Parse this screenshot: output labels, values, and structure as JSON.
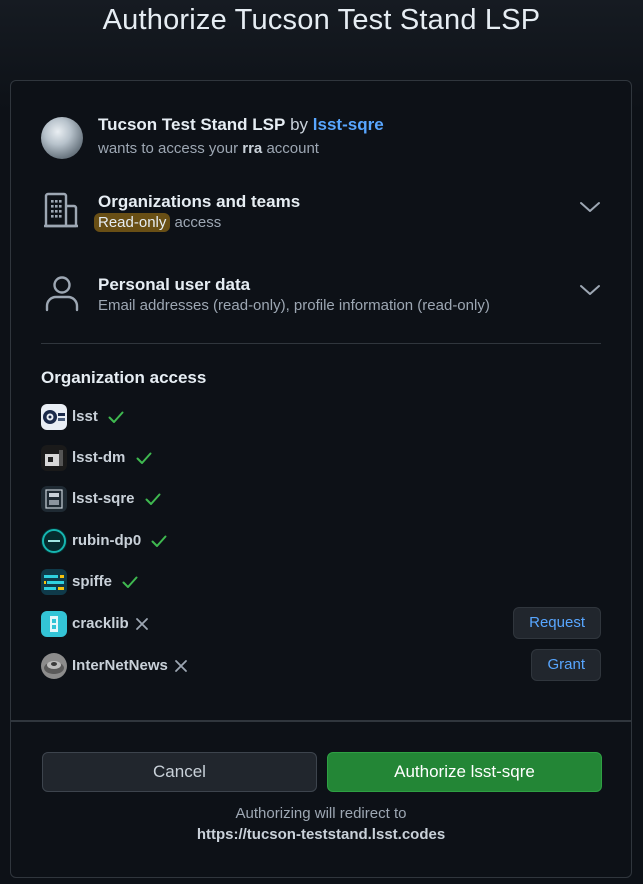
{
  "page_title": "Authorize Tucson Test Stand LSP",
  "app": {
    "name": "Tucson Test Stand LSP",
    "by": "by",
    "owner": "lsst-sqre",
    "access_prefix": "wants to access your",
    "account": "rra",
    "access_suffix": "account"
  },
  "permissions": [
    {
      "title": "Organizations and teams",
      "highlight": "Read-only",
      "desc": "access",
      "icon": "organization-icon"
    },
    {
      "title": "Personal user data",
      "desc": "Email addresses (read-only), profile information (read-only)",
      "icon": "person-icon"
    }
  ],
  "org_access": {
    "heading": "Organization access",
    "orgs": [
      {
        "name": "lsst",
        "status": "granted"
      },
      {
        "name": "lsst-dm",
        "status": "granted"
      },
      {
        "name": "lsst-sqre",
        "status": "granted"
      },
      {
        "name": "rubin-dp0",
        "status": "granted"
      },
      {
        "name": "spiffe",
        "status": "granted"
      },
      {
        "name": "cracklib",
        "status": "denied",
        "action": "Request"
      },
      {
        "name": "InterNetNews",
        "status": "denied",
        "action": "Grant"
      }
    ]
  },
  "buttons": {
    "cancel": "Cancel",
    "authorize": "Authorize lsst-sqre"
  },
  "redirect": {
    "note": "Authorizing will redirect to",
    "url": "https://tucson-teststand.lsst.codes"
  },
  "colors": {
    "background": "#0d1117",
    "link": "#58a6ff",
    "success": "#3fb950",
    "authorize_button": "#238636",
    "highlight": "#694f15"
  }
}
